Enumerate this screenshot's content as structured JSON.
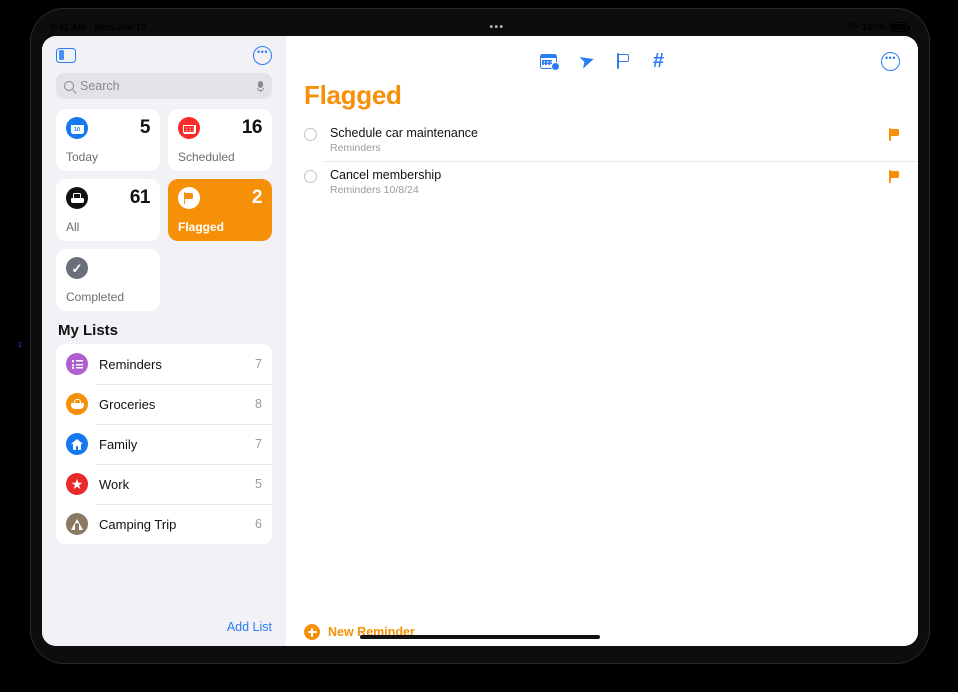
{
  "status_bar": {
    "time": "9:41 AM",
    "date": "Mon Jun 10",
    "multitask_dots": "•••",
    "battery_percent": "100%",
    "wifi_icon": "wifi-icon",
    "battery_icon": "battery-full-icon"
  },
  "sidebar": {
    "toggle_icon": "sidebar-toggle-icon",
    "more_icon": "ellipsis-circle-icon",
    "more_label": "•••",
    "search": {
      "placeholder": "Search",
      "value": "",
      "search_icon": "search-icon",
      "mic_icon": "microphone-icon"
    },
    "smart_lists": [
      {
        "label": "Today",
        "count": "5",
        "icon": "calendar-day-icon",
        "day_number": "10",
        "color": "#1478f0",
        "active": false
      },
      {
        "label": "Scheduled",
        "count": "16",
        "icon": "calendar-grid-icon",
        "color": "#fa2a2a",
        "active": false
      },
      {
        "label": "All",
        "count": "61",
        "icon": "inbox-tray-icon",
        "color": "#111111",
        "active": false
      },
      {
        "label": "Flagged",
        "count": "2",
        "icon": "flag-icon",
        "color": "#f79009",
        "active": true
      },
      {
        "label": "Completed",
        "count": "",
        "icon": "checkmark-circle-icon",
        "color": "#69707a",
        "active": false
      }
    ],
    "my_lists_title": "My Lists",
    "lists": [
      {
        "name": "Reminders",
        "count": "7",
        "icon": "bulleted-list-icon",
        "color": "#b05fd0"
      },
      {
        "name": "Groceries",
        "count": "8",
        "icon": "basket-icon",
        "color": "#f79009"
      },
      {
        "name": "Family",
        "count": "7",
        "icon": "house-icon",
        "color": "#1478f0"
      },
      {
        "name": "Work",
        "count": "5",
        "icon": "star-icon",
        "color": "#ea2a2a"
      },
      {
        "name": "Camping Trip",
        "count": "6",
        "icon": "tent-icon",
        "color": "#8a7a63"
      }
    ],
    "add_list_label": "Add List"
  },
  "content": {
    "toolbar_icons": [
      {
        "name": "scheduled-calendar-icon"
      },
      {
        "name": "location-arrow-icon",
        "glyph": "➤"
      },
      {
        "name": "flag-outline-icon"
      },
      {
        "name": "hashtag-icon",
        "glyph": "#"
      }
    ],
    "more_icon": "ellipsis-circle-icon",
    "more_label": "•••",
    "title": "Flagged",
    "title_color": "#f79009",
    "reminders": [
      {
        "title": "Schedule car maintenance",
        "meta": "Reminders",
        "flagged": true,
        "checkbox_icon": "unchecked-circle-icon",
        "flag_icon": "flag-icon"
      },
      {
        "title": "Cancel membership",
        "meta": "Reminders  10/8/24",
        "flagged": true,
        "checkbox_icon": "unchecked-circle-icon",
        "flag_icon": "flag-icon"
      }
    ],
    "new_reminder_label": "New Reminder",
    "new_reminder_icon": "plus-circle-icon"
  },
  "annotation": {
    "marker": "2"
  }
}
